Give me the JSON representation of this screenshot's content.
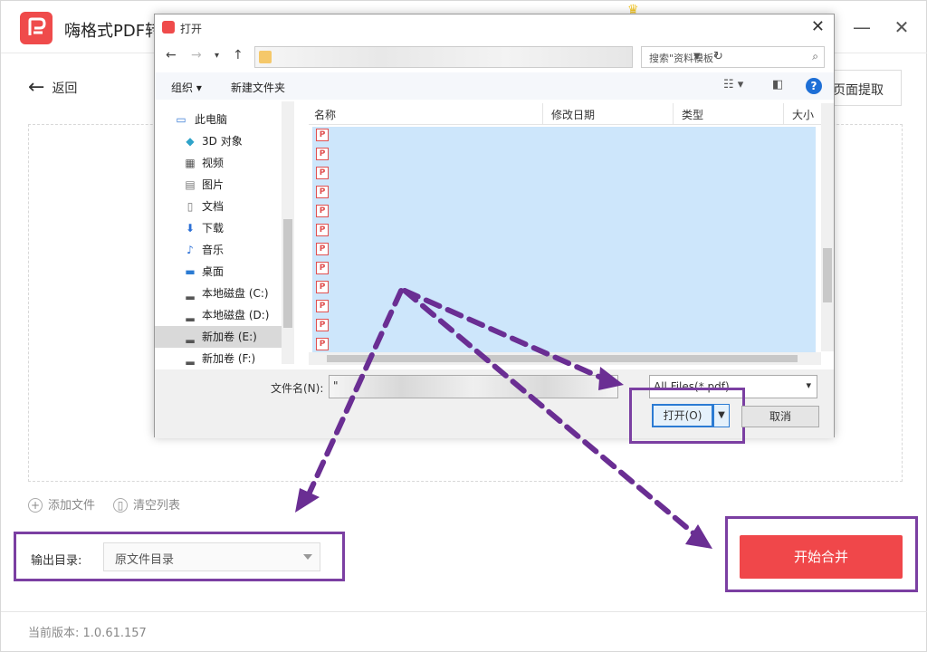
{
  "app": {
    "title": "嗨格式PDF转",
    "back_label": "返回",
    "extract_label": "页面提取",
    "add_file_label": "添加文件",
    "clear_list_label": "清空列表",
    "output_label": "输出目录:",
    "output_value": "原文件目录",
    "merge_label": "开始合并",
    "version": "当前版本: 1.0.61.157"
  },
  "dialog": {
    "title": "打开",
    "search_placeholder": "搜索\"资料模板\"",
    "organize_label": "组织 ▾",
    "new_folder_label": "新建文件夹",
    "columns": [
      "名称",
      "修改日期",
      "类型",
      "大小"
    ],
    "tree": [
      {
        "label": "此电脑",
        "icon": "computer-icon"
      },
      {
        "label": "3D 对象",
        "icon": "cube-icon"
      },
      {
        "label": "视频",
        "icon": "video-icon"
      },
      {
        "label": "图片",
        "icon": "image-icon"
      },
      {
        "label": "文档",
        "icon": "document-icon"
      },
      {
        "label": "下载",
        "icon": "download-icon"
      },
      {
        "label": "音乐",
        "icon": "music-icon"
      },
      {
        "label": "桌面",
        "icon": "desktop-icon"
      },
      {
        "label": "本地磁盘 (C:)",
        "icon": "drive-icon"
      },
      {
        "label": "本地磁盘 (D:)",
        "icon": "drive-icon"
      },
      {
        "label": "新加卷 (E:)",
        "icon": "drive-icon"
      },
      {
        "label": "新加卷 (F:)",
        "icon": "drive-icon"
      }
    ],
    "file_name_label": "文件名(N):",
    "file_name_value": "\"",
    "filter_value": "All Files(*.pdf)",
    "open_label": "打开(O)",
    "cancel_label": "取消"
  }
}
